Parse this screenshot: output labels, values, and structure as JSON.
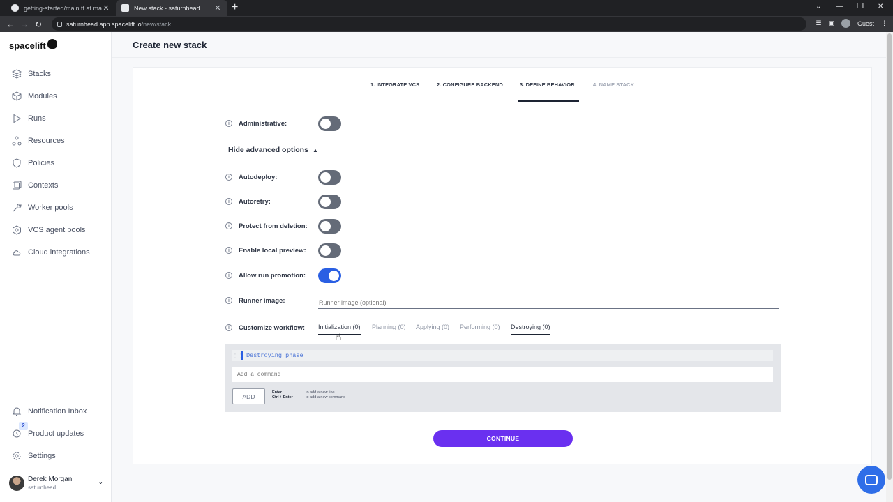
{
  "browser": {
    "tabs": [
      {
        "title": "getting-started/main.tf at main ·",
        "close": "✕"
      },
      {
        "title": "New stack - saturnhead",
        "close": "✕"
      }
    ],
    "new_tab": "+",
    "url_host": "saturnhead.app.spacelift.io",
    "url_path": "/new/stack",
    "profile_label": "Guest"
  },
  "app": {
    "logo_text": "spacelift",
    "page_title": "Create new stack"
  },
  "sidebar": {
    "items": [
      {
        "label": "Stacks",
        "icon": "layers-icon"
      },
      {
        "label": "Modules",
        "icon": "cube-icon"
      },
      {
        "label": "Runs",
        "icon": "play-icon"
      },
      {
        "label": "Resources",
        "icon": "resources-icon"
      },
      {
        "label": "Policies",
        "icon": "shield-icon"
      },
      {
        "label": "Contexts",
        "icon": "contexts-icon"
      },
      {
        "label": "Worker pools",
        "icon": "wrench-icon"
      },
      {
        "label": "VCS agent pools",
        "icon": "hexagon-icon"
      },
      {
        "label": "Cloud integrations",
        "icon": "cloud-icon"
      }
    ],
    "bottom_items": [
      {
        "label": "Notification Inbox",
        "icon": "bell-icon"
      },
      {
        "label": "Product updates",
        "icon": "news-icon"
      },
      {
        "label": "Settings",
        "icon": "gear-icon"
      }
    ],
    "updates_badge": "2",
    "user": {
      "name": "Derek Morgan",
      "account": "saturnhead"
    }
  },
  "steps": [
    {
      "label": "1. INTEGRATE VCS",
      "state": "done"
    },
    {
      "label": "2. CONFIGURE BACKEND",
      "state": "done"
    },
    {
      "label": "3. DEFINE BEHAVIOR",
      "state": "active"
    },
    {
      "label": "4. NAME STACK",
      "state": "disabled"
    }
  ],
  "form": {
    "administrative": {
      "label": "Administrative:",
      "enabled": false
    },
    "advanced_toggle": "Hide advanced options",
    "autodeploy": {
      "label": "Autodeploy:",
      "enabled": false
    },
    "autoretry": {
      "label": "Autoretry:",
      "enabled": false
    },
    "protect_from_deletion": {
      "label": "Protect from deletion:",
      "enabled": false
    },
    "enable_local_preview": {
      "label": "Enable local preview:",
      "enabled": false
    },
    "allow_run_promotion": {
      "label": "Allow run promotion:",
      "enabled": true
    },
    "runner_image": {
      "label": "Runner image:",
      "placeholder": "Runner image (optional)",
      "value": ""
    },
    "customize_workflow": {
      "label": "Customize workflow:",
      "tabs": [
        "Initialization (0)",
        "Planning (0)",
        "Applying (0)",
        "Performing (0)",
        "Destroying (0)"
      ],
      "selected_tab": "Destroying (0)"
    },
    "editor": {
      "phase_label": "Destroying phase",
      "command_placeholder": "Add a command",
      "add_button": "ADD",
      "hint_keys": [
        "Enter",
        "Ctrl + Enter"
      ],
      "hint_texts": [
        "to add a new line",
        "to add a new command"
      ]
    },
    "continue_button": "CONTINUE"
  },
  "colors": {
    "accent_purple": "#6a30f0",
    "toggle_on": "#2a5fe3",
    "toggle_off": "#646b78"
  }
}
